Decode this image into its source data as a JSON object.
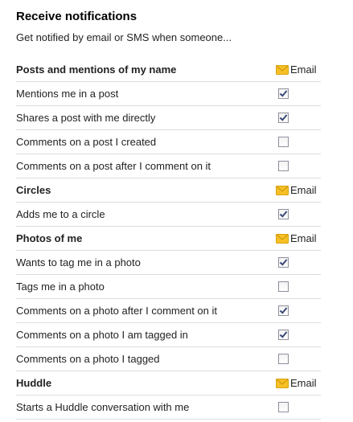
{
  "title": "Receive notifications",
  "subtitle": "Get notified by email or SMS when someone...",
  "email_label": "Email",
  "colors": {
    "envelope": "#f6c026",
    "divider": "#dddddd"
  },
  "sections": [
    {
      "title": "Posts and mentions of my name",
      "rows": [
        {
          "label": "Mentions me in a post",
          "checked": true
        },
        {
          "label": "Shares a post with me directly",
          "checked": true
        },
        {
          "label": "Comments on a post I created",
          "checked": false
        },
        {
          "label": "Comments on a post after I comment on it",
          "checked": false
        }
      ]
    },
    {
      "title": "Circles",
      "rows": [
        {
          "label": "Adds me to a circle",
          "checked": true
        }
      ]
    },
    {
      "title": "Photos of me",
      "rows": [
        {
          "label": "Wants to tag me in a photo",
          "checked": true
        },
        {
          "label": "Tags me in a photo",
          "checked": false
        },
        {
          "label": "Comments on a photo after I comment on it",
          "checked": true
        },
        {
          "label": "Comments on a photo I am tagged in",
          "checked": true
        },
        {
          "label": "Comments on a photo I tagged",
          "checked": false
        }
      ]
    },
    {
      "title": "Huddle",
      "rows": [
        {
          "label": "Starts a Huddle conversation with me",
          "checked": false
        }
      ]
    }
  ]
}
